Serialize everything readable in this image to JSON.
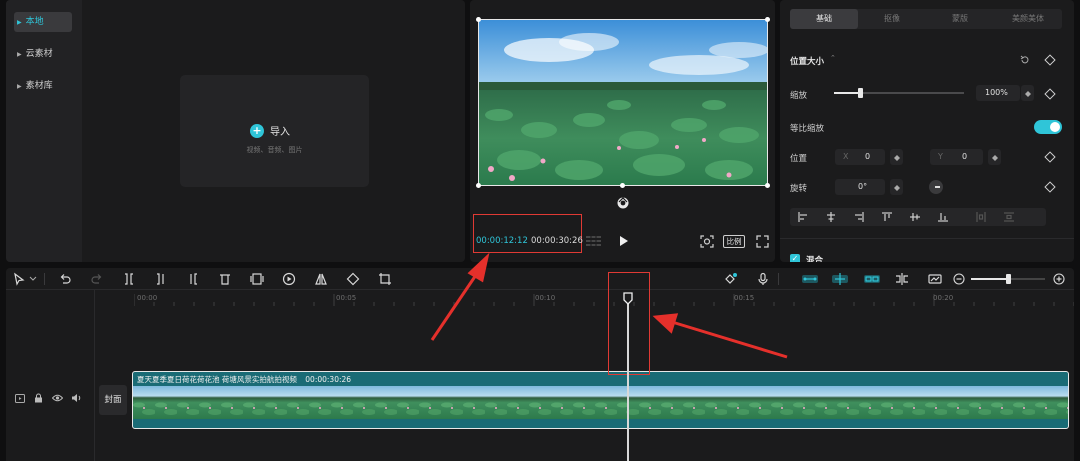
{
  "library": {
    "sidebar": [
      {
        "label": "本地",
        "active": true
      },
      {
        "label": "云素材",
        "active": false
      },
      {
        "label": "素材库",
        "active": false
      }
    ],
    "import_label": "导入",
    "import_hint": "视频、音频、图片"
  },
  "player": {
    "current_time": "00:00:12:12",
    "total_time": "00:00:30:26",
    "ratio_label": "比例"
  },
  "properties": {
    "tabs": [
      {
        "label": "基础",
        "active": true
      },
      {
        "label": "抠像",
        "active": false
      },
      {
        "label": "蒙版",
        "active": false
      },
      {
        "label": "美颜美体",
        "active": false
      }
    ],
    "section_title": "位置大小",
    "scale_label": "缩放",
    "scale_value": "100%",
    "scale_level": 0.2,
    "uniform_scale_label": "等比缩放",
    "uniform_scale_on": true,
    "position_label": "位置",
    "pos_x_label": "X",
    "pos_x_value": "0",
    "pos_y_label": "Y",
    "pos_y_value": "0",
    "rotate_label": "旋转",
    "rotate_value": "0°",
    "blend_label": "混合"
  },
  "timeline": {
    "ruler": [
      "00:00",
      "00:05",
      "00:10",
      "00:15",
      "00:20"
    ],
    "cover_label": "封面",
    "clip_title": "夏天夏季夏日荷花荷花池 荷塘风景实拍航拍视频",
    "clip_duration": "00:00:30:26",
    "zoom_level": 0.5
  },
  "colors": {
    "accent": "#2fc5d8",
    "highlight_box": "#e03a34",
    "clip_bg": "#1a6b75"
  }
}
